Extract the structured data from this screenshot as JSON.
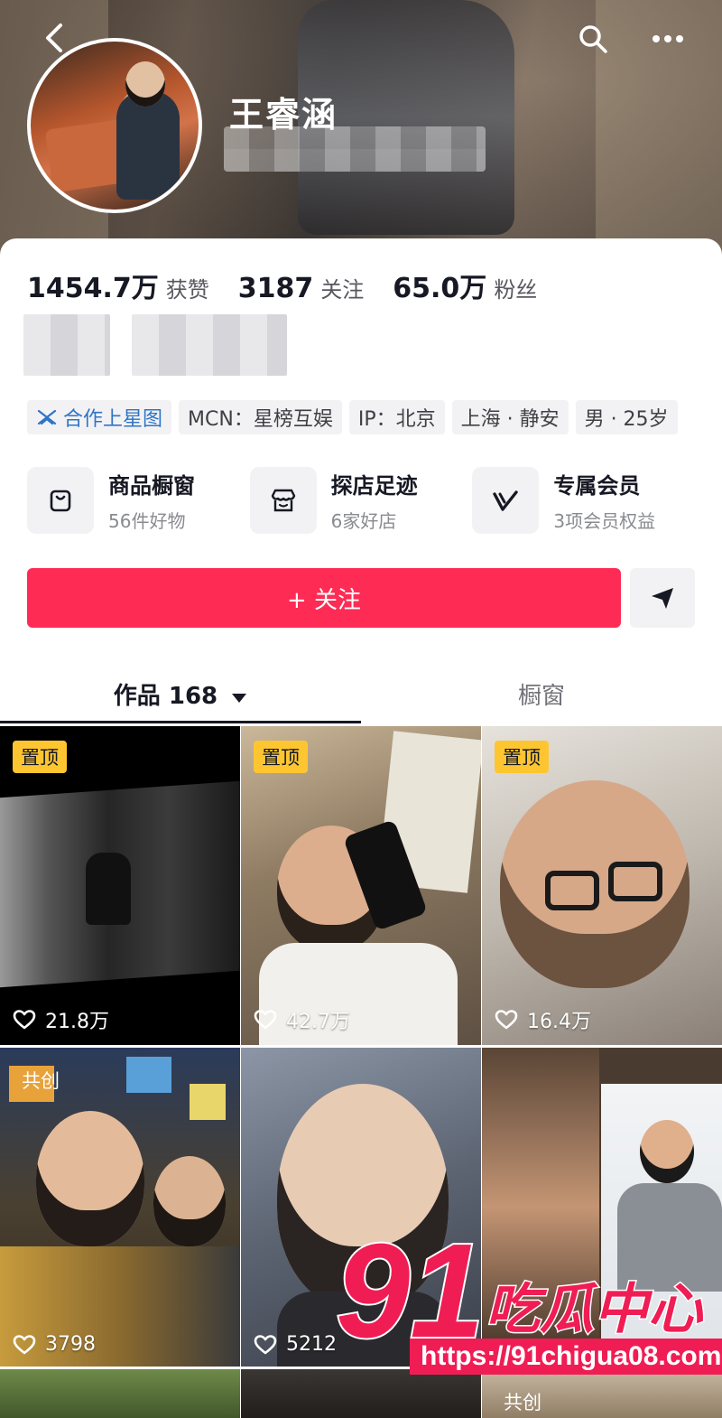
{
  "header": {
    "nickname": "王睿涵",
    "icons": [
      "back-icon",
      "search-icon",
      "more-icon"
    ]
  },
  "stats": [
    {
      "value": "1454.7万",
      "label": "获赞"
    },
    {
      "value": "3187",
      "label": "关注"
    },
    {
      "value": "65.0万",
      "label": "粉丝"
    }
  ],
  "tags": {
    "cooperate": "合作上星图",
    "mcn": "MCN：星榜互娱",
    "ip": "IP：北京",
    "location": "上海 · 静安",
    "gender_age": "男 · 25岁"
  },
  "services": [
    {
      "title": "商品橱窗",
      "sub": "56件好物",
      "icon": "shopping-bag-icon"
    },
    {
      "title": "探店足迹",
      "sub": "6家好店",
      "icon": "store-icon"
    },
    {
      "title": "专属会员",
      "sub": "3项会员权益",
      "icon": "vip-v-icon"
    }
  ],
  "actions": {
    "follow_label": "+ 关注"
  },
  "tabs": {
    "works": "作品 168",
    "window": "橱窗"
  },
  "videos": [
    {
      "badge": "置顶",
      "likes": "21.8万"
    },
    {
      "badge": "置顶",
      "likes": "42.7万"
    },
    {
      "badge": "置顶",
      "likes": "16.4万"
    },
    {
      "badge": "共创",
      "likes": "3798"
    },
    {
      "badge": "",
      "likes": "5212"
    },
    {
      "badge": "",
      "likes": ""
    },
    {
      "badge": "",
      "likes": ""
    },
    {
      "badge": "",
      "likes": ""
    },
    {
      "badge": "共创",
      "likes": ""
    }
  ],
  "watermark": {
    "logo_number": "91",
    "logo_text": "吃瓜中心",
    "url": "https://91chigua08.com"
  },
  "colors": {
    "accent": "#fe2c55",
    "pin_badge": "#fdc631",
    "link_tag": "#2f74c8"
  }
}
